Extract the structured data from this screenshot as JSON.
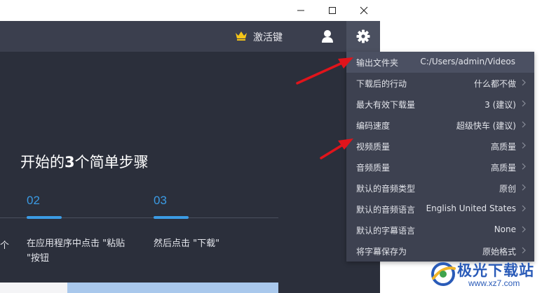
{
  "window_controls": {
    "minimize": "minimize-icon",
    "maximize": "maximize-icon",
    "close": "close-icon"
  },
  "header": {
    "activate_label": "激活键",
    "icons": [
      "crown-icon",
      "user-icon",
      "gear-icon"
    ],
    "crown_color": "#f5c518"
  },
  "main": {
    "steps_title_prefix": "开始的",
    "steps_title_num": "3",
    "steps_title_suffix": "个简单步骤",
    "clipped_text_1": "个",
    "steps": [
      {
        "num": "02",
        "text_line1": "在应用程序中点击 \"粘贴",
        "text_line2": "\"按钮"
      },
      {
        "num": "03",
        "text_line1": "然后点击 \"下载\""
      }
    ]
  },
  "settings_menu": {
    "items": [
      {
        "label": "输出文件夹",
        "value": "C:/Users/admin/Videos"
      },
      {
        "label": "下载后的行动",
        "value": "什么都不做"
      },
      {
        "label": "最大有效下载量",
        "value": "3 (建议)"
      },
      {
        "label": "编码速度",
        "value": "超级快车 (建议)"
      },
      {
        "label": "视频质量",
        "value": "高质量"
      },
      {
        "label": "音频质量",
        "value": "高质量"
      },
      {
        "label": "默认的音频类型",
        "value": "原创"
      },
      {
        "label": "默认的音频语言",
        "value": "English United States"
      },
      {
        "label": "默认的字幕语言",
        "value": "None"
      },
      {
        "label": "将字幕保存为",
        "value": "原始格式"
      }
    ]
  },
  "watermark": {
    "title": "极光下载站",
    "url": "www.xz7.com"
  },
  "colors": {
    "accent_blue": "#3b9be4",
    "header_bg": "#3b3f4e",
    "main_bg": "#2b2f3b",
    "menu_bg": "#3d4150",
    "arrow_red": "#e0141b"
  }
}
